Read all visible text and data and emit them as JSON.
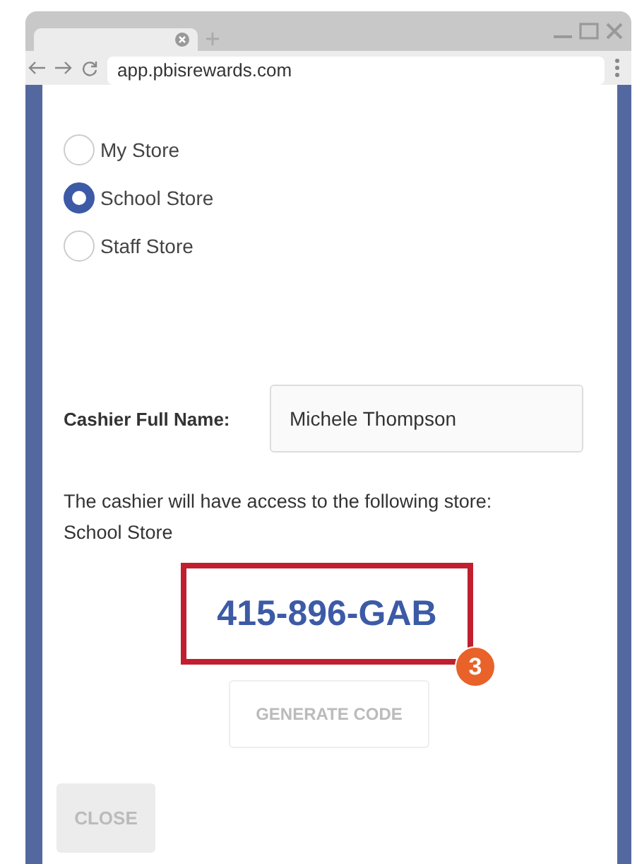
{
  "browser": {
    "url": "app.pbisrewards.com"
  },
  "stores": [
    {
      "label": "My Store",
      "selected": false
    },
    {
      "label": "School Store",
      "selected": true
    },
    {
      "label": "Staff Store",
      "selected": false
    }
  ],
  "cashier": {
    "label": "Cashier Full Name:",
    "value": "Michele Thompson"
  },
  "access_message": "The cashier will have access to the following store:",
  "store_name": "School Store",
  "code": "415-896-GAB",
  "callout_badge": "3",
  "buttons": [
    {
      "kind": "generate",
      "label": "GENERATE CODE"
    },
    {
      "kind": "close",
      "label": "CLOSE"
    }
  ]
}
